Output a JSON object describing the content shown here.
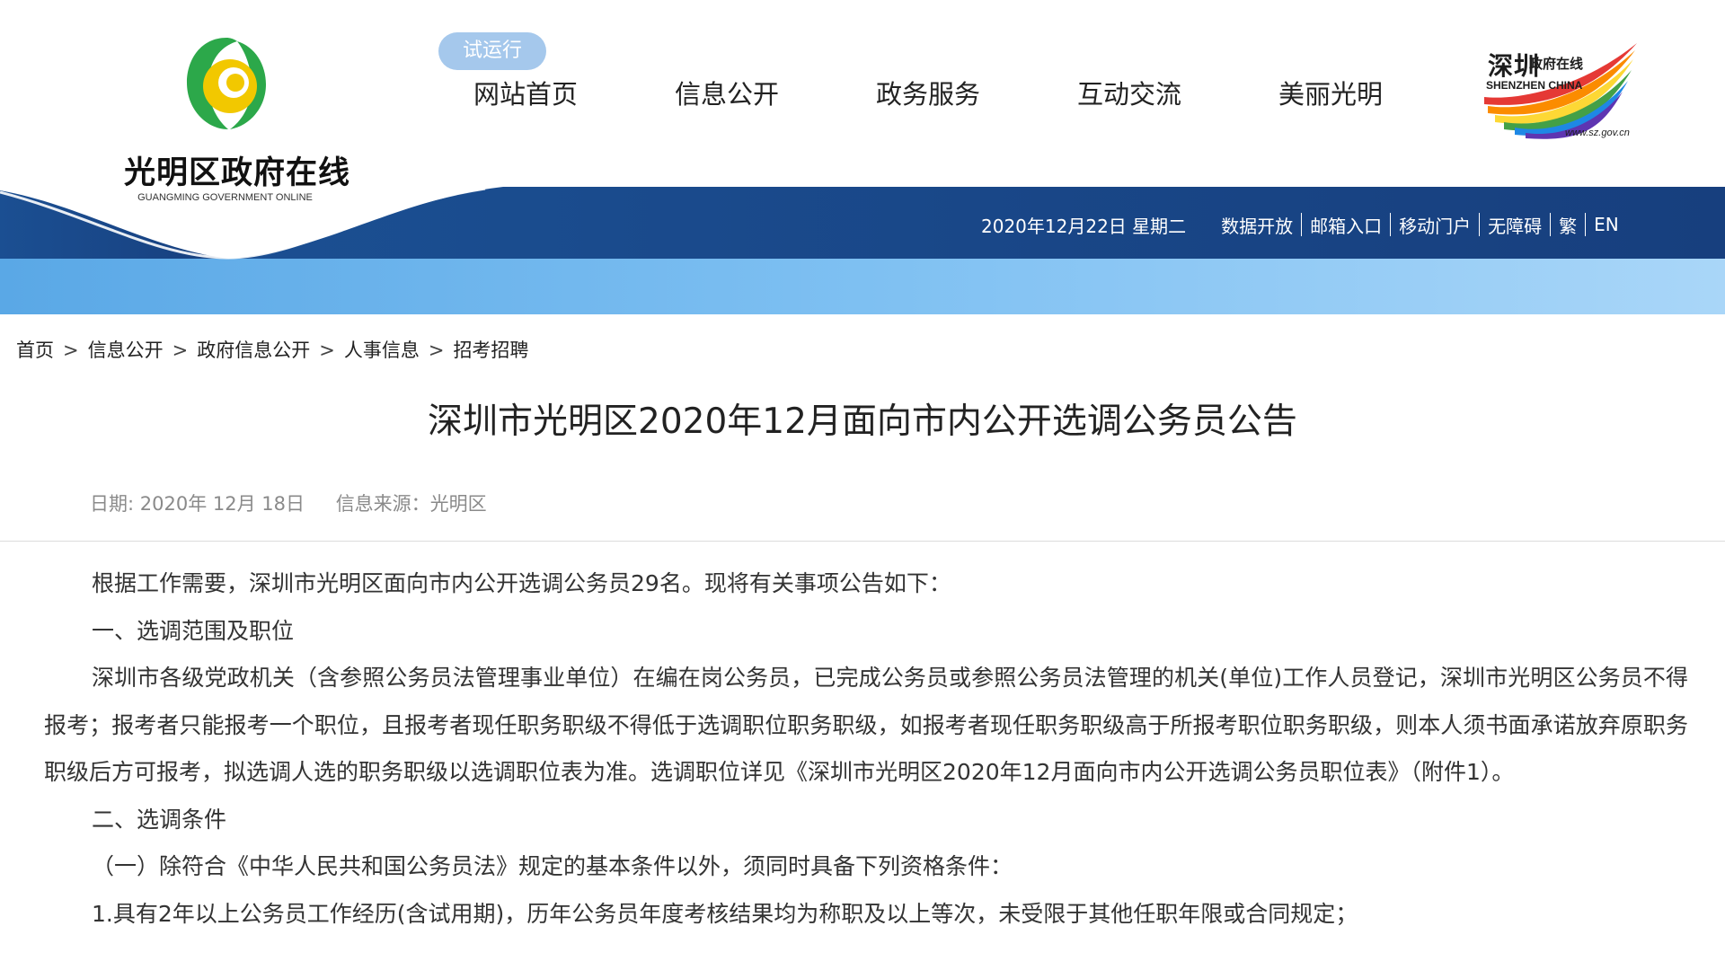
{
  "header": {
    "logo_title": "光明区政府在线",
    "logo_subtitle": "GUANGMING GOVERNMENT ONLINE",
    "trial_badge": "试运行",
    "nav": [
      {
        "label": "网站首页"
      },
      {
        "label": "信息公开"
      },
      {
        "label": "政务服务"
      },
      {
        "label": "互动交流"
      },
      {
        "label": "美丽光明"
      }
    ],
    "sz_logo": {
      "cn_big": "深圳",
      "cn_small": "政府在线",
      "en": "SHENZHEN CHINA",
      "url": "www.sz.gov.cn"
    },
    "utility": {
      "date": "2020年12月22日 星期二",
      "links": [
        "数据开放",
        "邮箱入口",
        "移动门户",
        "无障碍",
        "繁",
        "EN"
      ]
    }
  },
  "breadcrumb": [
    "首页",
    "信息公开",
    "政府信息公开",
    "人事信息",
    "招考招聘"
  ],
  "breadcrumb_separator": ">",
  "article": {
    "title": "深圳市光明区2020年12月面向市内公开选调公务员公告",
    "date": "日期: 2020年 12月 18日",
    "source": "信息来源：光明区",
    "paragraphs": [
      "根据工作需要，深圳市光明区面向市内公开选调公务员29名。现将有关事项公告如下：",
      "一、选调范围及职位",
      "深圳市各级党政机关（含参照公务员法管理事业单位）在编在岗公务员，已完成公务员或参照公务员法管理的机关(单位)工作人员登记，深圳市光明区公务员不得报考；报考者只能报考一个职位，且报考者现任职务职级不得低于选调职位职务职级，如报考者现任职务职级高于所报考职位职务职级，则本人须书面承诺放弃原职务职级后方可报考，拟选调人选的职务职级以选调职位表为准。选调职位详见《深圳市光明区2020年12月面向市内公开选调公务员职位表》（附件1）。",
      "二、选调条件",
      "（一）除符合《中华人民共和国公务员法》规定的基本条件以外，须同时具备下列资格条件：",
      "1.具有2年以上公务员工作经历(含试用期)，历年公务员年度考核结果均为称职及以上等次，未受限于其他任职年限或合同规定；"
    ]
  },
  "colors": {
    "header_blue": "#1a4a8c",
    "band_light_blue": "#7fc0f0",
    "trial_badge_bg": "#a5c8ec",
    "logo_green": "#2ca84a",
    "logo_yellow": "#f2c800"
  }
}
